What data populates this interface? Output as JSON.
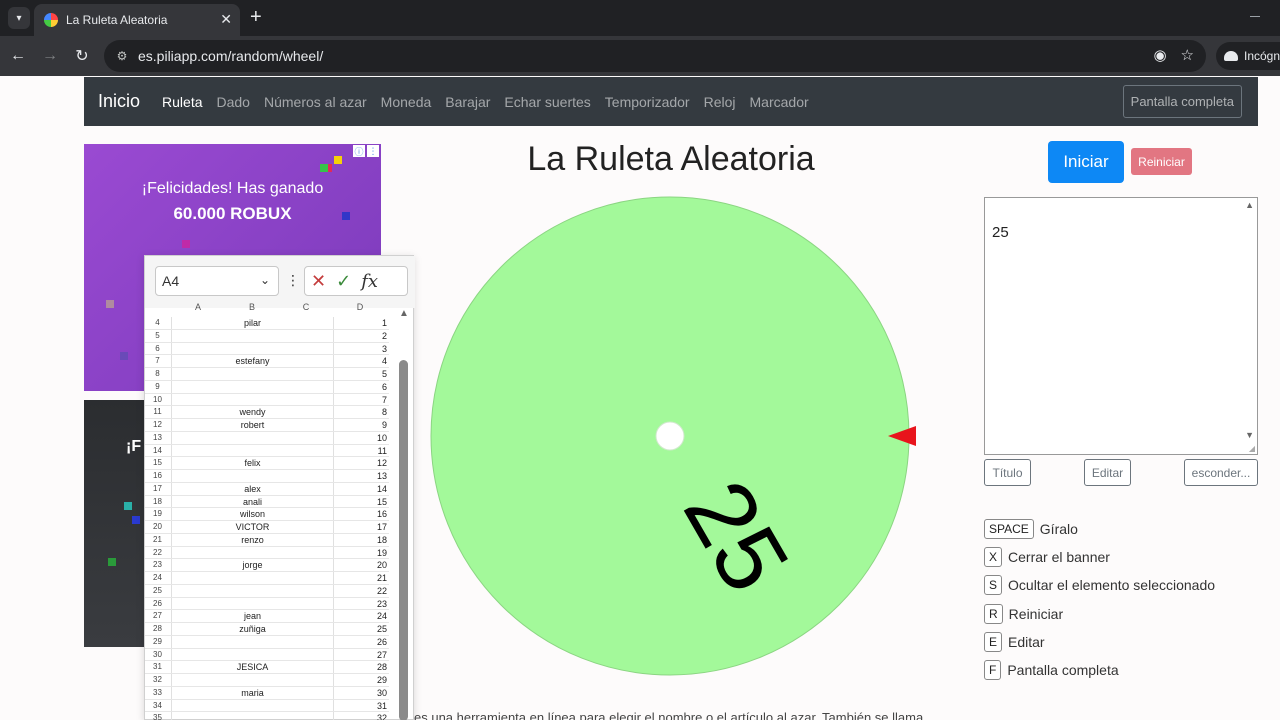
{
  "browser": {
    "tab_title": "La Ruleta Aleatoria",
    "url": "es.piliapp.com/random/wheel/",
    "profile_label": "Incógni"
  },
  "site_nav": {
    "brand": "Inicio",
    "links": [
      "Ruleta",
      "Dado",
      "Números al azar",
      "Moneda",
      "Barajar",
      "Echar suertes",
      "Temporizador",
      "Reloj",
      "Marcador"
    ],
    "active": "Ruleta",
    "fullscreen_label": "Pantalla completa"
  },
  "ads": {
    "ad1_title": "¡Felicidades! Has ganado",
    "ad1_subtitle": "60.000 ROBUX",
    "ad2_text": "¡F"
  },
  "spreadsheet": {
    "name_box": "A4",
    "columns": [
      "A",
      "B",
      "C",
      "D"
    ],
    "rows": [
      {
        "n": "4",
        "b": "pilar",
        "d": "1"
      },
      {
        "n": "5",
        "b": "",
        "d": "2"
      },
      {
        "n": "6",
        "b": "",
        "d": "3"
      },
      {
        "n": "7",
        "b": "estefany",
        "d": "4"
      },
      {
        "n": "8",
        "b": "",
        "d": "5"
      },
      {
        "n": "9",
        "b": "",
        "d": "6"
      },
      {
        "n": "10",
        "b": "",
        "d": "7"
      },
      {
        "n": "11",
        "b": "wendy",
        "d": "8"
      },
      {
        "n": "12",
        "b": "robert",
        "d": "9"
      },
      {
        "n": "13",
        "b": "",
        "d": "10"
      },
      {
        "n": "14",
        "b": "",
        "d": "11"
      },
      {
        "n": "15",
        "b": "felix",
        "d": "12"
      },
      {
        "n": "16",
        "b": "",
        "d": "13"
      },
      {
        "n": "17",
        "b": "alex",
        "d": "14"
      },
      {
        "n": "18",
        "b": "anali",
        "d": "15"
      },
      {
        "n": "19",
        "b": "wilson",
        "d": "16"
      },
      {
        "n": "20",
        "b": "VICTOR",
        "d": "17"
      },
      {
        "n": "21",
        "b": "renzo",
        "d": "18"
      },
      {
        "n": "22",
        "b": "",
        "d": "19"
      },
      {
        "n": "23",
        "b": "jorge",
        "d": "20"
      },
      {
        "n": "24",
        "b": "",
        "d": "21"
      },
      {
        "n": "25",
        "b": "",
        "d": "22"
      },
      {
        "n": "26",
        "b": "",
        "d": "23"
      },
      {
        "n": "27",
        "b": "jean",
        "d": "24"
      },
      {
        "n": "28",
        "b": "zuñiga",
        "d": "25"
      },
      {
        "n": "29",
        "b": "",
        "d": "26"
      },
      {
        "n": "30",
        "b": "",
        "d": "27"
      },
      {
        "n": "31",
        "b": "JESICA",
        "d": "28"
      },
      {
        "n": "32",
        "b": "",
        "d": "29"
      },
      {
        "n": "33",
        "b": "maria",
        "d": "30"
      },
      {
        "n": "34",
        "b": "",
        "d": "31"
      },
      {
        "n": "35",
        "b": "",
        "d": "32"
      }
    ]
  },
  "main": {
    "title": "La Ruleta Aleatoria",
    "wheel_label": "25",
    "wheel_color": "#a3f99a",
    "pointer_color": "#e8141c",
    "start_label": "Iniciar",
    "reset_label": "Reiniciar",
    "items_text": "25",
    "title_btn": "Título",
    "edit_btn": "Editar",
    "hide_btn": "esconder...",
    "shortcuts": [
      {
        "key": "SPACE",
        "label": "Gíralo"
      },
      {
        "key": "X",
        "label": "Cerrar el banner"
      },
      {
        "key": "S",
        "label": "Ocultar el elemento seleccionado"
      },
      {
        "key": "R",
        "label": "Reiniciar"
      },
      {
        "key": "E",
        "label": "Editar"
      },
      {
        "key": "F",
        "label": "Pantalla completa"
      }
    ],
    "bottom_text": "es una herramienta en línea para elegir el nombre o el artículo al azar. También se llama"
  }
}
